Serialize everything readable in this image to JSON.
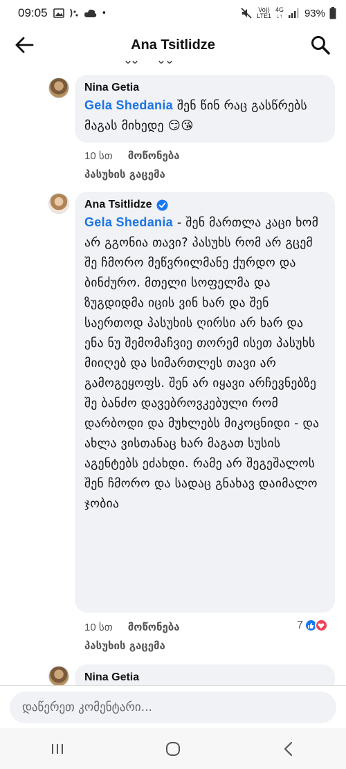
{
  "status_bar": {
    "time": "09:05",
    "dot": "•",
    "volte_top": "Vo))",
    "volte_bottom": "LTE1",
    "network": "4G",
    "battery": "93%"
  },
  "header": {
    "title": "Ana Tsitlidze"
  },
  "comments": [
    {
      "author": "Nina Getia",
      "mention": "Gela Shedania",
      "text": " შენ წინ რაც გასწრებს მაგას მიხედე 😏😘",
      "time": "10 სთ",
      "like_label": "მოწონება",
      "reply_label": "პასუხის გაცემა"
    },
    {
      "author": "Ana Tsitlidze",
      "verified": true,
      "mention": "Gela Shedania",
      "text": " - შენ მართლა კაცი ხომ არ გგონია თავი? პასუხს რომ არ გცემ შე ჩმორო მეწვრილმანე ქურდო და ბინძურო. მთელი სოფელმა და ზუგდიდმა იცის ვინ ხარ და შენ საერთოდ პასუხის ღირსი არ ხარ და ენა ნუ შემომაჩვიე თორემ ისეთ პასუხს მიიღებ და სიმართლეს თავი არ გამოგეყოფს. შენ არ იყავი არჩევნებზე შე ბანძო დავებროვკებული რომ დარბოდი და მუხლებს მიკოცნიდი - და ახლა ვისთანაც ხარ მაგათ სუსის აგენტებს ეძახდი. რამე არ შეგეშალოს შენ ჩმორო და სადაც გნახავ დაიმალო ჯობია",
      "time": "10 სთ",
      "like_label": "მოწონება",
      "reply_label": "პასუხის გაცემა",
      "reaction_count": "7"
    },
    {
      "author": "Nina Getia"
    }
  ],
  "composer": {
    "placeholder": "დაწერეთ კომენტარი..."
  },
  "colors": {
    "mention": "#1b74e4",
    "bubble": "#f0f2f5",
    "like": "#1877f2",
    "love": "#f33e58"
  }
}
